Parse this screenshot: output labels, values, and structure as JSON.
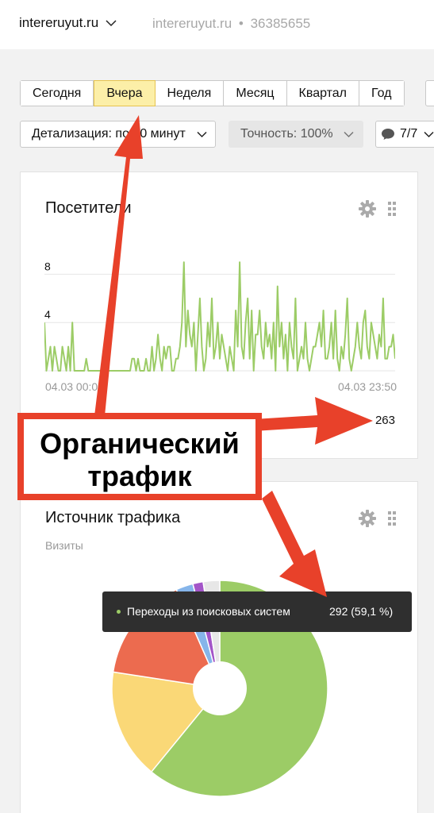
{
  "header": {
    "site_selector": "intereruyut.ru",
    "site_name": "intereruyut.ru",
    "separator": "•",
    "counter_id": "36385655"
  },
  "period_tabs": [
    {
      "label": "Сегодня",
      "active": false
    },
    {
      "label": "Вчера",
      "active": true
    },
    {
      "label": "Неделя",
      "active": false
    },
    {
      "label": "Месяц",
      "active": false
    },
    {
      "label": "Квартал",
      "active": false
    },
    {
      "label": "Год",
      "active": false
    }
  ],
  "toolbar": {
    "detail_label": "Детализация: по 10 минут",
    "accuracy_label": "Точность: 100%",
    "segments_label": "7/7"
  },
  "visitors_card": {
    "title": "Посетители",
    "x_start": "04.03 00:00",
    "x_end": "04.03 23:50",
    "total": "263"
  },
  "traffic_card": {
    "title": "Источник трафика",
    "subtitle": "Визиты"
  },
  "tooltip": {
    "label": "Переходы из поисковых систем",
    "value": "292 (59,1 %)"
  },
  "annotation": {
    "line1": "Органический",
    "line2": "трафик"
  },
  "colors": {
    "accent_red": "#e8412a",
    "line_green": "#9ccc66",
    "active_tab": "#fcefa8"
  },
  "chart_data": [
    {
      "type": "line",
      "title": "Посетители",
      "x_start": "04.03 00:00",
      "x_end": "04.03 23:50",
      "ylim": [
        0,
        10
      ],
      "yticks": [
        4,
        8
      ],
      "grid": true,
      "values": [
        4,
        0,
        1,
        2,
        0,
        2,
        1,
        0,
        0,
        2,
        1,
        0,
        2,
        0,
        4,
        0,
        0,
        0,
        0,
        0,
        0,
        1,
        0,
        0,
        0,
        0,
        0,
        0,
        0,
        0,
        1,
        0,
        0,
        0,
        0,
        0,
        0,
        0,
        0,
        0,
        0,
        0,
        0,
        0,
        1,
        1,
        0,
        1,
        0,
        0,
        0,
        1,
        0,
        0,
        2,
        0,
        1,
        3,
        1,
        0,
        2,
        1,
        2,
        2,
        0,
        0,
        1,
        1,
        2,
        4,
        9,
        2,
        5,
        3,
        2,
        4,
        0,
        3,
        6,
        2,
        0,
        1,
        4,
        2,
        6,
        1,
        2,
        4,
        1,
        3,
        2,
        1,
        0,
        2,
        1,
        0,
        5,
        2,
        9,
        2,
        1,
        4,
        6,
        1,
        5,
        0,
        3,
        3,
        5,
        2,
        1,
        4,
        2,
        3,
        1,
        4,
        0,
        7,
        2,
        4,
        1,
        3,
        0,
        4,
        2,
        1,
        6,
        0,
        1,
        2,
        1,
        4,
        1,
        0,
        1,
        2,
        2,
        3,
        4,
        2,
        5,
        1,
        1,
        2,
        4,
        1,
        5,
        1,
        0,
        2,
        1,
        3,
        6,
        1,
        0,
        1,
        2,
        4,
        2,
        1,
        4,
        5,
        2,
        1,
        4,
        3,
        2,
        1,
        3,
        2,
        6,
        1,
        1,
        2,
        2,
        3,
        1
      ]
    },
    {
      "type": "pie",
      "title": "Источник трафика",
      "subtitle": "Визиты",
      "slices": [
        {
          "value": 59.1,
          "color": "#9ccc66"
        },
        {
          "value": 16.0,
          "color": "#fad877"
        },
        {
          "value": 15.5,
          "color": "#ec6b4f"
        },
        {
          "value": 2.5,
          "color": "#86b5ea"
        },
        {
          "value": 1.5,
          "color": "#a355c8"
        },
        {
          "value": 2.4,
          "color": "#e7e7e7"
        }
      ]
    }
  ]
}
